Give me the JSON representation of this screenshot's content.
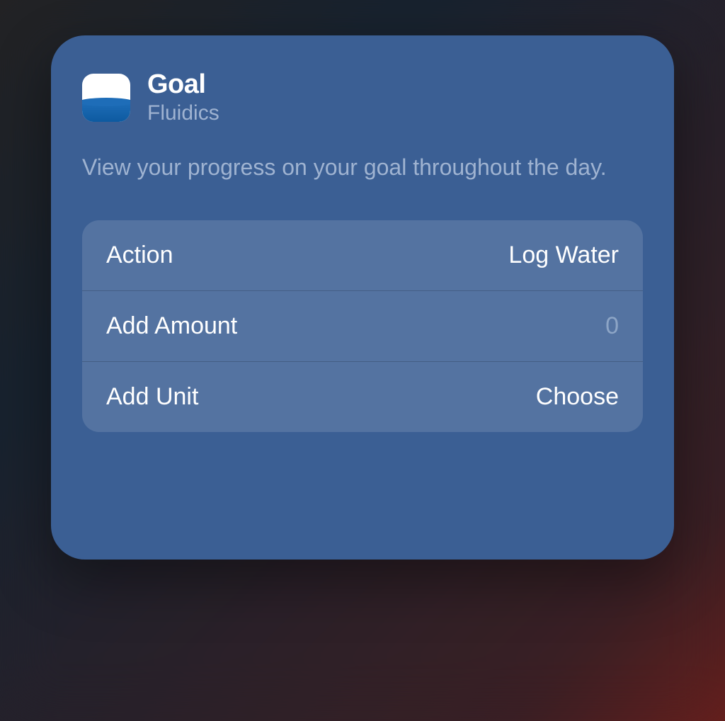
{
  "widget": {
    "title": "Goal",
    "app_name": "Fluidics",
    "description": "View your progress on your goal throughout the day.",
    "options": [
      {
        "label": "Action",
        "value": "Log Water",
        "is_placeholder": false
      },
      {
        "label": "Add Amount",
        "value": "0",
        "is_placeholder": true
      },
      {
        "label": "Add Unit",
        "value": "Choose",
        "is_placeholder": false
      }
    ]
  }
}
